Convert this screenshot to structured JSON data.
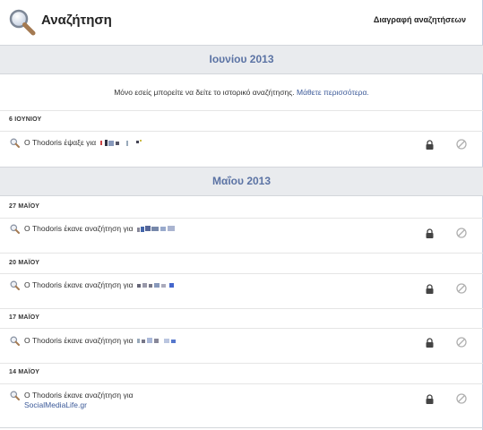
{
  "header": {
    "title": "Αναζήτηση",
    "clear_label": "Διαγραφή αναζητήσεων"
  },
  "months": [
    {
      "label": "Ιουνίου 2013"
    },
    {
      "label": "Μαΐου 2013"
    }
  ],
  "notice": {
    "text": "Μόνο εσείς μπορείτε να δείτε το ιστορικό αναζήτησης.",
    "link": "Μάθετε περισσότερα."
  },
  "days": [
    {
      "label": "6 ΙΟΥΝΙΟΥ",
      "entry": "Ο Thodoris έψαξε για"
    },
    {
      "label": "27 ΜΑΪΟΥ",
      "entry": "Ο Thodoris έκανε αναζήτηση για"
    },
    {
      "label": "20 ΜΑΪΟΥ",
      "entry": "Ο Thodoris έκανε αναζήτηση για"
    },
    {
      "label": "17 ΜΑΪΟΥ",
      "entry": "Ο Thodoris έκανε αναζήτηση για"
    },
    {
      "label": "14 ΜΑΪΟΥ",
      "entry": "Ο Thodoris έκανε αναζήτηση για",
      "link": "SocialMediaLife.gr"
    }
  ],
  "icons": {
    "header": "search-icon",
    "row": "search-icon",
    "privacy": "lock-icon",
    "hide": "hide-icon"
  },
  "colors": {
    "accent": "#5b73a4",
    "link": "#3b5998",
    "band": "#e9ebee"
  }
}
